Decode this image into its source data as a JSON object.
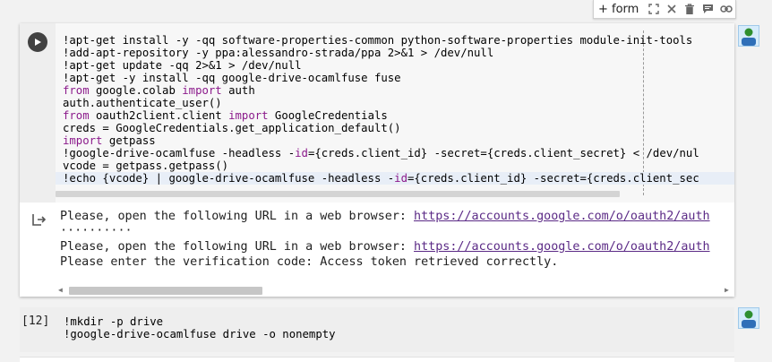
{
  "toolbar": {
    "form_label": "+ form",
    "icons": [
      "expand-icon",
      "close-icon",
      "trash-icon",
      "comment-icon",
      "link-icon"
    ]
  },
  "cell1": {
    "code_lines": [
      "!apt-get install -y -qq software-properties-common python-software-properties module-init-tools",
      "!add-apt-repository -y ppa:alessandro-strada/ppa 2>&1 > /dev/null",
      "!apt-get update -qq 2>&1 > /dev/null",
      "!apt-get -y install -qq google-drive-ocamlfuse fuse",
      "from google.colab import auth",
      "auth.authenticate_user()",
      "from oauth2client.client import GoogleCredentials",
      "creds = GoogleCredentials.get_application_default()",
      "import getpass",
      "!google-drive-ocamlfuse -headless -id={creds.client_id} -secret={creds.client_secret} < /dev/nul",
      "vcode = getpass.getpass()",
      "!echo {vcode} | google-drive-ocamlfuse -headless -id={creds.client_id} -secret={creds.client_sec"
    ],
    "output": {
      "line1_text": "Please, open the following URL in a web browser: ",
      "line1_link": "https://accounts.google.com/o/oauth2/auth",
      "line2_text": "··········",
      "line3_text": "Please, open the following URL in a web browser: ",
      "line3_link": "https://accounts.google.com/o/oauth2/auth",
      "line4_text": "Please enter the verification code: Access token retrieved correctly."
    }
  },
  "cell2": {
    "execution_count": "[12]",
    "code_lines": [
      "!mkdir -p drive",
      "!google-drive-ocamlfuse drive -o nonempty"
    ]
  },
  "colors": {
    "keyword": "#8b1a8b",
    "link": "#5b2a86",
    "run_button": "#424242"
  }
}
